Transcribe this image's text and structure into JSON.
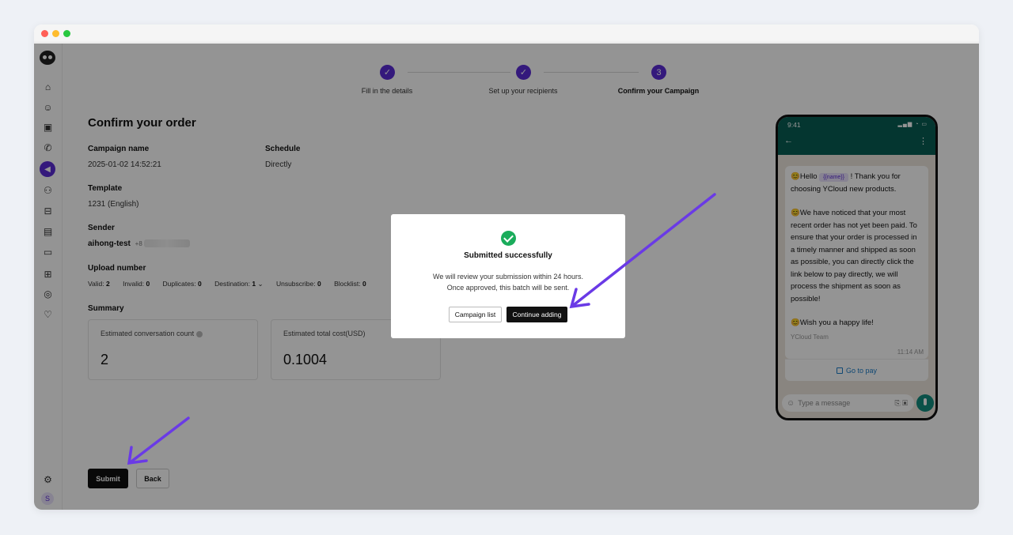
{
  "stepper": {
    "steps": [
      {
        "label": "Fill in the details",
        "state": "done"
      },
      {
        "label": "Set up your recipients",
        "state": "done"
      },
      {
        "label": "Confirm your Campaign",
        "state": "current",
        "number": "3"
      }
    ]
  },
  "order": {
    "title": "Confirm your order",
    "campaign_name_label": "Campaign name",
    "campaign_name_value": "2025-01-02 14:52:21",
    "schedule_label": "Schedule",
    "schedule_value": "Directly",
    "template_label": "Template",
    "template_value": "1231 (English)",
    "sender_label": "Sender",
    "sender_value": "aihong-test",
    "sender_phone": "+8",
    "upload_label": "Upload number",
    "upload": {
      "valid_label": "Valid:",
      "valid": "2",
      "invalid_label": "Invalid:",
      "invalid": "0",
      "duplicates_label": "Duplicates:",
      "duplicates": "0",
      "destination_label": "Destination:",
      "destination": "1",
      "unsubscribe_label": "Unsubscribe:",
      "unsubscribe": "0",
      "blocklist_label": "Blocklist:",
      "blocklist": "0"
    },
    "summary_label": "Summary",
    "est_count_label": "Estimated conversation count",
    "est_count_value": "2",
    "est_cost_label": "Estimated total cost(USD)",
    "est_cost_value": "0.1004"
  },
  "actions": {
    "submit": "Submit",
    "back": "Back"
  },
  "phone": {
    "time": "9:41",
    "greeting_prefix": "😊Hello",
    "name_tag": "{{name}}",
    "greeting_suffix": "! Thank you for choosing YCloud new products.",
    "para2": "😊We have noticed that your most recent order has not yet been paid. To ensure that your order is processed in a timely manner and shipped as soon as possible,  you can directly click the link below to pay directly, we will process the shipment as soon as possible!",
    "para3": "😊Wish you a happy life!",
    "signature": "YCloud Team",
    "timestamp": "11:14 AM",
    "button": "Go to pay",
    "input_placeholder": "Type a message"
  },
  "modal": {
    "title": "Submitted successfully",
    "line1": "We will review your submission within 24 hours.",
    "line2": "Once approved, this batch will be sent.",
    "campaign_list": "Campaign list",
    "continue_adding": "Continue adding"
  },
  "colors": {
    "accent": "#5b2bd6",
    "success": "#1aac5b",
    "whatsapp": "#075e54",
    "annotation_arrow": "#6a3ae6"
  },
  "sidebar_icons": [
    "home-icon",
    "chat-icon",
    "contacts-icon",
    "phone-icon",
    "megaphone-icon",
    "flow-icon",
    "bot-icon",
    "ads-icon",
    "billing-icon",
    "apps-icon",
    "api-icon",
    "heart-icon",
    "gear-icon"
  ]
}
